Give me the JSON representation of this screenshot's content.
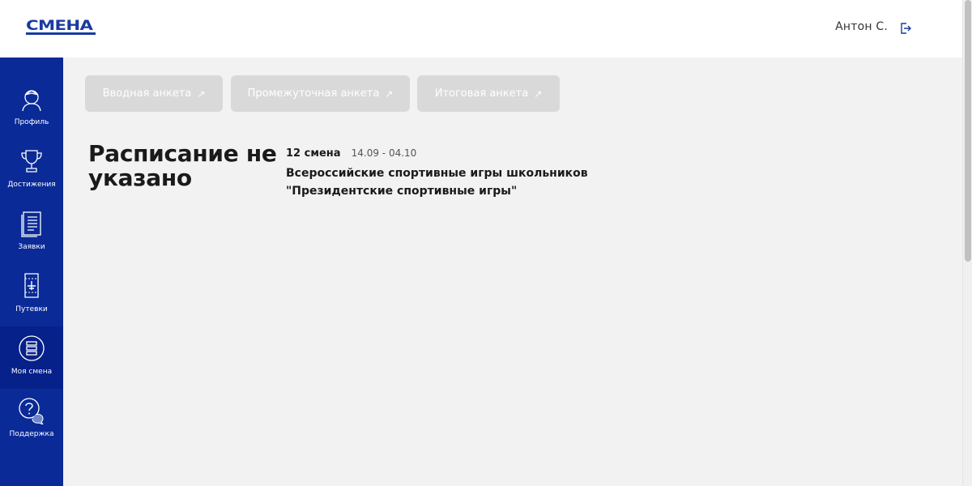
{
  "header": {
    "logo_text": "СМЕНА",
    "user_name": "Антон С."
  },
  "colors": {
    "sidebar": "#0a2a97",
    "brand": "#1a3aa0",
    "button_disabled": "#d9d9d9",
    "background": "#f2f2f2"
  },
  "sidebar": {
    "items": [
      {
        "label": "Профиль",
        "icon": "profile-icon"
      },
      {
        "label": "Достижения",
        "icon": "trophy-icon"
      },
      {
        "label": "Заявки",
        "icon": "applications-icon"
      },
      {
        "label": "Путевки",
        "icon": "ticket-icon"
      },
      {
        "label": "Моя смена",
        "icon": "my-shift-icon",
        "active": true
      },
      {
        "label": "Поддержка",
        "icon": "support-icon"
      }
    ]
  },
  "surveys": [
    {
      "label": "Вводная анкета",
      "arrow": "↗"
    },
    {
      "label": "Промежуточная анкета",
      "arrow": "↗"
    },
    {
      "label": "Итоговая анкета",
      "arrow": "↗"
    }
  ],
  "main": {
    "title": "Расписание не указано",
    "shift_number": "12 смена",
    "shift_dates": "14.09 - 04.10",
    "shift_name": "Всероссийские спортивные игры школьников \"Президентские спортивные игры\""
  }
}
